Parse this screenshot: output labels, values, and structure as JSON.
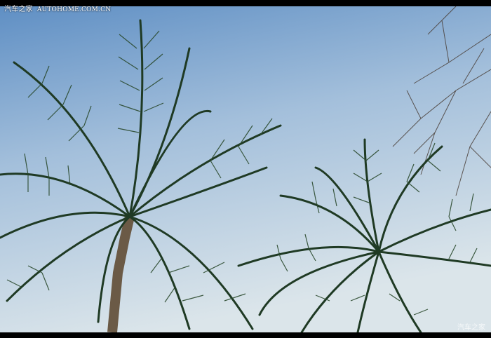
{
  "watermark": {
    "brand": "汽车之家",
    "site": "AUTOHOME.COM.CN",
    "bottom_brand": "汽车之家"
  },
  "photo": {
    "subject": "coconut palm trees against sky",
    "colors": {
      "sky_top": "#6f9bc9",
      "sky_mid": "#a9c4de",
      "sky_bottom": "#d7e3ea",
      "frond": "#1f3a24",
      "frond_light": "#4e6b3c",
      "trunk": "#6b5a46"
    }
  }
}
